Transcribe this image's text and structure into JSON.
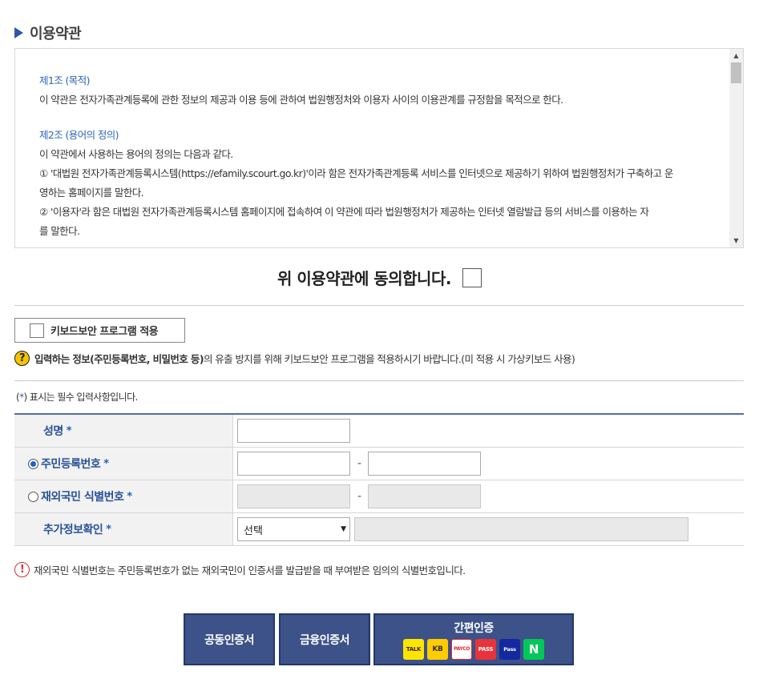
{
  "section": {
    "title": "이용약관"
  },
  "terms": {
    "articles": [
      {
        "title": "제1조 (목적)",
        "lines": [
          "이 약관은 전자가족관계등록에 관한 정보의 제공과 이용 등에 관하여 법원행정처와 이용자 사이의 이용관계를 규정함을 목적으로 한다."
        ]
      },
      {
        "title": "제2조 (용어의 정의)",
        "lines": [
          "이 약관에서 사용하는 용어의 정의는 다음과 같다.",
          "① '대법원 전자가족관계등록시스템(https://efamily.scourt.go.kr)'이라 함은 전자가족관계등록 서비스를 인터넷으로 제공하기 위하여 법원행정처가 구축하고 운",
          "영하는 홈페이지를 말한다.",
          "② '이용자'라 함은 대법원 전자가족관계등록시스템 홈페이지에 접속하여 이 약관에 따라 법원행정처가 제공하는 인터넷 열람발급 등의 서비스를 이용하는 자",
          "를 말한다."
        ]
      }
    ]
  },
  "agree": {
    "label": "위 이용약관에 동의합니다."
  },
  "keyboard_security": {
    "label": "키보드보안 프로그램 적용"
  },
  "notice": {
    "icon": "question-icon",
    "bold": "입력하는 정보(주민등록번호, 비밀번호 등)",
    "rest": "의 유출 방지를 위해 키보드보안 프로그램을 적용하시기 바랍니다.(미 적용 시 가상키보드 사용)"
  },
  "required_note": {
    "prefix": "(",
    "star": "*",
    "suffix": ") 표시는 필수 입력사항입니다."
  },
  "form": {
    "star": "*",
    "name_label": "성명",
    "rrn_label": "주민등록번호",
    "foreign_label": "재외국민 식별번호",
    "extra_label": "추가정보확인",
    "dash": "-",
    "select_value": "선택"
  },
  "warning": {
    "icon": "exclamation-icon",
    "text": "재외국민 식별번호는 주민등록번호가 없는 재외국민이 인증서를 발급받을 때 부여받은 임의의 식별번호입니다."
  },
  "buttons": {
    "public_cert": "공동인증서",
    "financial_cert": "금융인증서",
    "simple_auth": "간편인증",
    "logos": {
      "kakao": "TALK",
      "kb": "KB",
      "payco": "PAYCO",
      "pass": "PASS",
      "samsung": "Pass",
      "naver": "N"
    }
  },
  "colors": {
    "accent": "#2a5298",
    "button_bg": "#3c5288",
    "title_marker": "#2c58a6"
  }
}
